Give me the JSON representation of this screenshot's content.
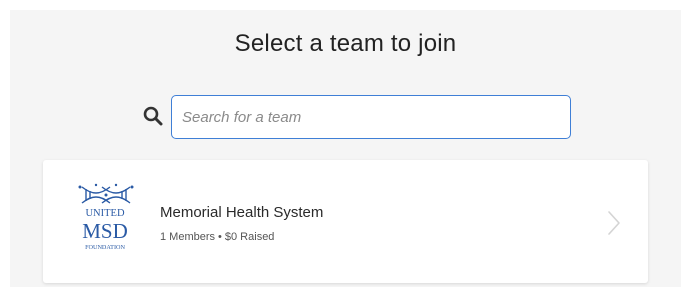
{
  "page": {
    "title": "Select a team to join"
  },
  "search": {
    "placeholder": "Search for a team",
    "value": ""
  },
  "teams": [
    {
      "name": "Memorial Health System",
      "members": "1 Members",
      "separator": "•",
      "raised": "$0 Raised",
      "logo": {
        "line1": "UNITED",
        "line2": "MSD",
        "line3": "FOUNDATION"
      }
    }
  ],
  "icons": {
    "search": "search-icon",
    "chevron": "chevron-right-icon",
    "logo": "united-msd-foundation-logo"
  },
  "colors": {
    "accent": "#3f7fd6",
    "background": "#f5f5f5",
    "logo_blue": "#2a5aa5"
  }
}
